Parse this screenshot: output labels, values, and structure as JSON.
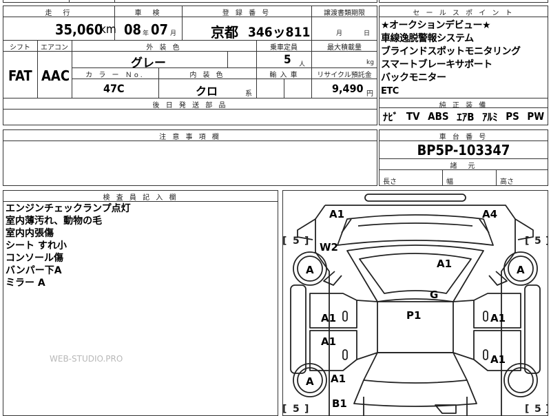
{
  "header": {
    "mileage": {
      "label": "走　行",
      "value": "35,060",
      "unit": "km"
    },
    "inspection": {
      "label": "車　検",
      "year": "08",
      "year_unit": "年",
      "month": "07",
      "month_unit": "月"
    },
    "registration": {
      "label": "登 録 番 号",
      "area": "京都",
      "number": "346ッ811"
    },
    "transfer": {
      "label": "譲渡書類期限",
      "month_unit": "月",
      "day_unit": "日"
    }
  },
  "row2": {
    "shift_label": "シフト",
    "shift": "FAT",
    "ac_label": "エアコン",
    "ac": "AAC",
    "exterior_label": "外 装 色",
    "exterior": "グレー",
    "capacity_label": "乗車定員",
    "capacity": "5",
    "capacity_unit": "人",
    "max_load_label": "最大積載量",
    "max_load_unit": "kg"
  },
  "row3": {
    "color_no_label": "カ ラ ー Ｎo.",
    "color_no": "47C",
    "interior_label": "内 装 色",
    "interior": "クロ",
    "interior_suffix": "系",
    "import_label": "輸 入 車",
    "recycle_label": "リサイクル預託金",
    "recycle": "9,490",
    "recycle_unit": "円"
  },
  "later_parts": {
    "label": "後 日 発 送 部 品"
  },
  "notes": {
    "label": "注 意 事 項 欄"
  },
  "sales": {
    "label": "セ ー ル ス ポ イ ン ト",
    "lines": [
      "★オークションデビュー★",
      "車線逸脱警報システム",
      "ブラインドスポットモニタリング",
      "スマートブレーキサポート",
      "バックモニター",
      "ETC"
    ]
  },
  "equipment": {
    "label": "純 正 装 備",
    "items": [
      "ﾅﾋﾞ",
      "TV",
      "ABS",
      "ｴｱB",
      "ｱﾙﾐ",
      "PS",
      "PW"
    ]
  },
  "chassis": {
    "label": "車 台 番 号",
    "value": "BP5P-103347"
  },
  "specs": {
    "label": "諸　元",
    "length": "長さ",
    "width": "幅",
    "height": "高さ"
  },
  "inspector": {
    "label": "検 査 員 記 入 欄",
    "lines": [
      "エンジンチェックランプ点灯",
      "室内薄汚れ、動物の毛",
      "室内内張傷",
      "シート すれ小",
      "コンソール傷",
      "バンパー下A",
      "ミラー A"
    ]
  },
  "watermark": "WEB-STUDIO.PRO",
  "diagram": {
    "tires": [
      "5",
      "5",
      "5",
      "5"
    ],
    "marks": {
      "front_left": "A1",
      "front_right": "A4",
      "w2": "W2",
      "hood": "A1",
      "tire_fl": "A",
      "tire_fr": "A",
      "tire_rl": "A",
      "glass": "G",
      "roof": "P1",
      "door_fl": "A1",
      "door_fr": "A1",
      "door_rl": "A1",
      "door_rr": "A1",
      "rear_fender_l": "A1",
      "rear_bumper": "B1"
    }
  }
}
